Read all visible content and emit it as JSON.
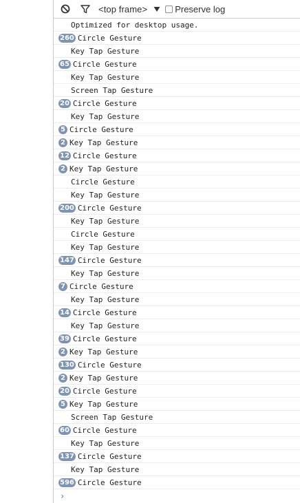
{
  "toolbar": {
    "clear_icon": "clear-console-icon",
    "filter_icon": "filter-icon",
    "frame_label": "<top frame>",
    "dropdown_icon": "dropdown-arrow-icon",
    "preserve_label": "Preserve log",
    "preserve_checked": false
  },
  "console": {
    "badge_color": "#7f93b2",
    "messages": [
      {
        "count": "",
        "text": "Optimized for desktop usage."
      },
      {
        "count": "260",
        "text": "Circle Gesture"
      },
      {
        "count": "",
        "text": "Key Tap Gesture"
      },
      {
        "count": "65",
        "text": "Circle Gesture"
      },
      {
        "count": "",
        "text": "Key Tap Gesture"
      },
      {
        "count": "",
        "text": "Screen Tap Gesture"
      },
      {
        "count": "20",
        "text": "Circle Gesture"
      },
      {
        "count": "",
        "text": "Key Tap Gesture"
      },
      {
        "count": "5",
        "text": "Circle Gesture"
      },
      {
        "count": "2",
        "text": "Key Tap Gesture"
      },
      {
        "count": "12",
        "text": "Circle Gesture"
      },
      {
        "count": "2",
        "text": "Key Tap Gesture"
      },
      {
        "count": "",
        "text": "Circle Gesture"
      },
      {
        "count": "",
        "text": "Key Tap Gesture"
      },
      {
        "count": "200",
        "text": "Circle Gesture"
      },
      {
        "count": "",
        "text": "Key Tap Gesture"
      },
      {
        "count": "",
        "text": "Circle Gesture"
      },
      {
        "count": "",
        "text": "Key Tap Gesture"
      },
      {
        "count": "147",
        "text": "Circle Gesture"
      },
      {
        "count": "",
        "text": "Key Tap Gesture"
      },
      {
        "count": "7",
        "text": "Circle Gesture"
      },
      {
        "count": "",
        "text": "Key Tap Gesture"
      },
      {
        "count": "14",
        "text": "Circle Gesture"
      },
      {
        "count": "",
        "text": "Key Tap Gesture"
      },
      {
        "count": "39",
        "text": "Circle Gesture"
      },
      {
        "count": "2",
        "text": "Key Tap Gesture"
      },
      {
        "count": "130",
        "text": "Circle Gesture"
      },
      {
        "count": "2",
        "text": "Key Tap Gesture"
      },
      {
        "count": "20",
        "text": "Circle Gesture"
      },
      {
        "count": "5",
        "text": "Key Tap Gesture"
      },
      {
        "count": "",
        "text": "Screen Tap Gesture"
      },
      {
        "count": "60",
        "text": "Circle Gesture"
      },
      {
        "count": "",
        "text": "Key Tap Gesture"
      },
      {
        "count": "137",
        "text": "Circle Gesture"
      },
      {
        "count": "",
        "text": "Key Tap Gesture"
      },
      {
        "count": "596",
        "text": "Circle Gesture"
      }
    ],
    "prompt_symbol": "›"
  }
}
